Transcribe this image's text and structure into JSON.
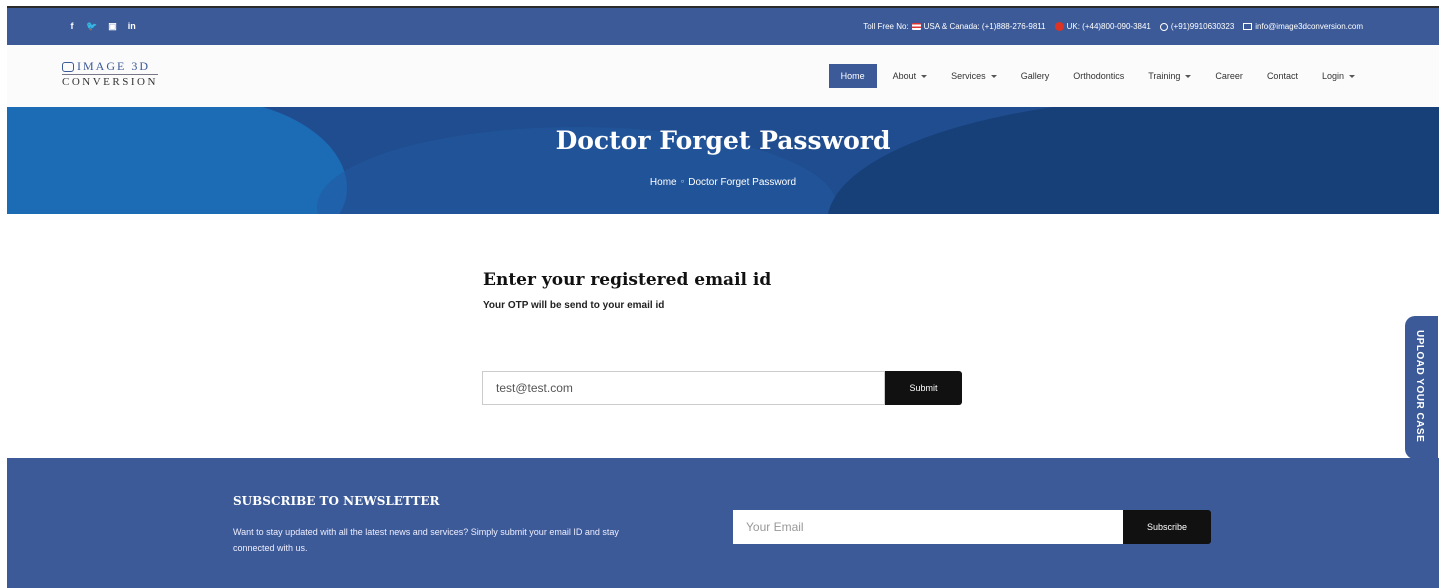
{
  "topbar": {
    "socials": [
      "f",
      "🐦",
      "▣",
      "in"
    ],
    "toll_free_label": "Toll Free No:",
    "usa_canada": "USA & Canada: (+1)888-276-9811",
    "uk": "UK: (+44)800-090-3841",
    "whatsapp": "(+91)9910630323",
    "email": "info@image3dconversion.com"
  },
  "logo": {
    "line1": "IMAGE 3D",
    "line2": "CONVERSION"
  },
  "nav": {
    "items": [
      {
        "label": "Home",
        "dropdown": false,
        "active": true
      },
      {
        "label": "About",
        "dropdown": true
      },
      {
        "label": "Services",
        "dropdown": true
      },
      {
        "label": "Gallery",
        "dropdown": false
      },
      {
        "label": "Orthodontics",
        "dropdown": false
      },
      {
        "label": "Training",
        "dropdown": true
      },
      {
        "label": "Career",
        "dropdown": false
      },
      {
        "label": "Contact",
        "dropdown": false
      },
      {
        "label": "Login",
        "dropdown": true
      }
    ]
  },
  "hero": {
    "title": "Doctor Forget Password",
    "breadcrumb_home": "Home",
    "breadcrumb_sep": "○",
    "breadcrumb_current": "Doctor Forget Password"
  },
  "form": {
    "heading": "Enter your registered email id",
    "subheading": "Your OTP will be send to your email id",
    "email_value": "test@test.com",
    "submit_label": "Submit"
  },
  "side_tab": {
    "label": "UPLOAD YOUR CASE"
  },
  "footer": {
    "heading": "SUBSCRIBE TO NEWSLETTER",
    "description": "Want to stay updated with all the latest news and services? Simply submit your email ID and stay connected with us.",
    "email_placeholder": "Your Email",
    "subscribe_label": "Subscribe"
  }
}
